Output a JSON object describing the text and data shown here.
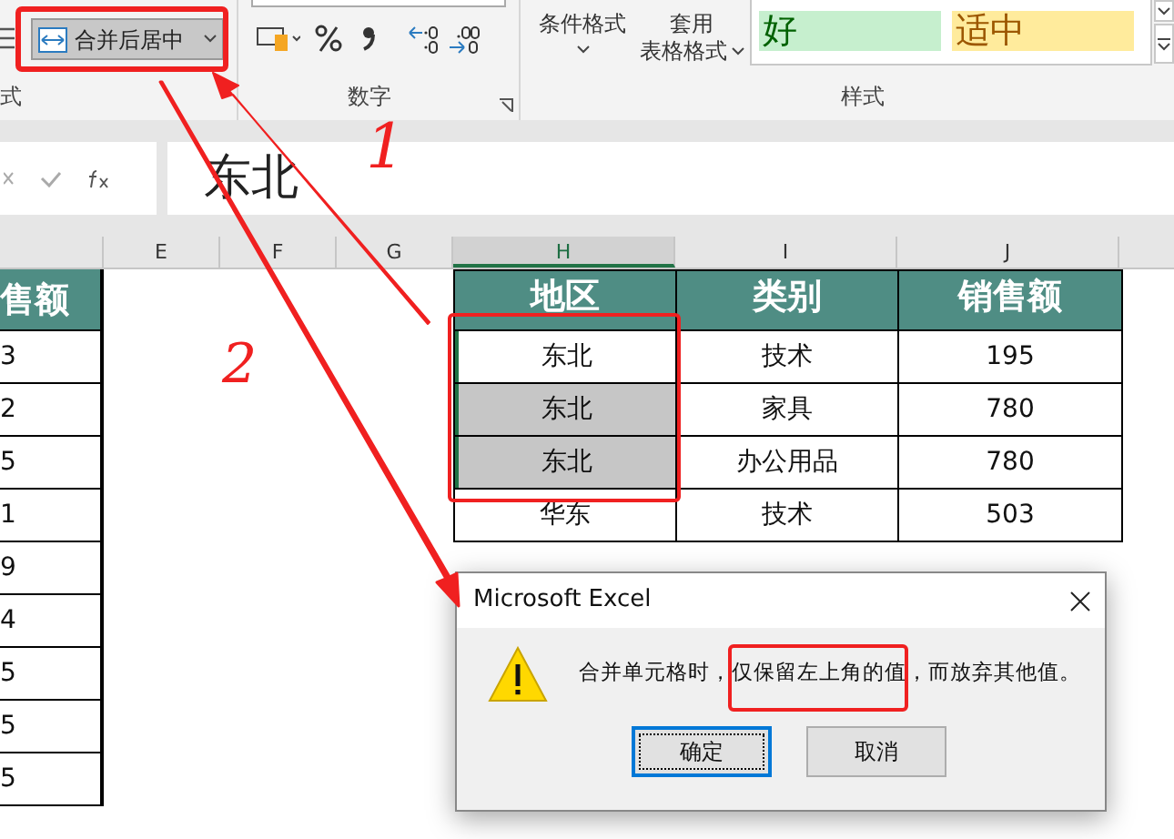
{
  "ribbon": {
    "alignment_group_label": "式",
    "merge_button": {
      "label": "合并后居中"
    },
    "number_group_label": "数字",
    "conditional_format_button": {
      "label": "条件格式"
    },
    "table_format_button": {
      "lines": [
        "套用",
        "表格格式"
      ]
    },
    "styles": [
      {
        "label": "好",
        "kind": "good"
      },
      {
        "label": "适中",
        "kind": "neutral"
      }
    ],
    "styles_group_label": "样式"
  },
  "formula_bar": {
    "value": "东北"
  },
  "column_headers": [
    {
      "label": "E",
      "selected": false
    },
    {
      "label": "F",
      "selected": false
    },
    {
      "label": "G",
      "selected": false
    },
    {
      "label": "H",
      "selected": true
    },
    {
      "label": "I",
      "selected": false
    },
    {
      "label": "J",
      "selected": false
    }
  ],
  "left_column": {
    "header": "售额",
    "values": [
      "3",
      "2",
      "5",
      "1",
      "9",
      "4",
      "5",
      "5",
      "5"
    ]
  },
  "table": {
    "columns": [
      "地区",
      "类别",
      "销售额"
    ],
    "rows": [
      {
        "cells": [
          "东北",
          "技术",
          "195"
        ],
        "selected": true,
        "active": true
      },
      {
        "cells": [
          "东北",
          "家具",
          "780"
        ],
        "selected": true,
        "active": false
      },
      {
        "cells": [
          "东北",
          "办公用品",
          "780"
        ],
        "selected": true,
        "active": false
      },
      {
        "cells": [
          "华东",
          "技术",
          "503"
        ],
        "selected": false
      }
    ]
  },
  "dialog": {
    "title": "Microsoft Excel",
    "message": "合并单元格时，仅保留左上角的值，而放弃其他值。",
    "buttons": [
      {
        "label": "确定",
        "selected": true
      },
      {
        "label": "取消",
        "selected": false
      }
    ]
  },
  "annotations": [
    {
      "label": "1"
    },
    {
      "label": "2"
    }
  ]
}
